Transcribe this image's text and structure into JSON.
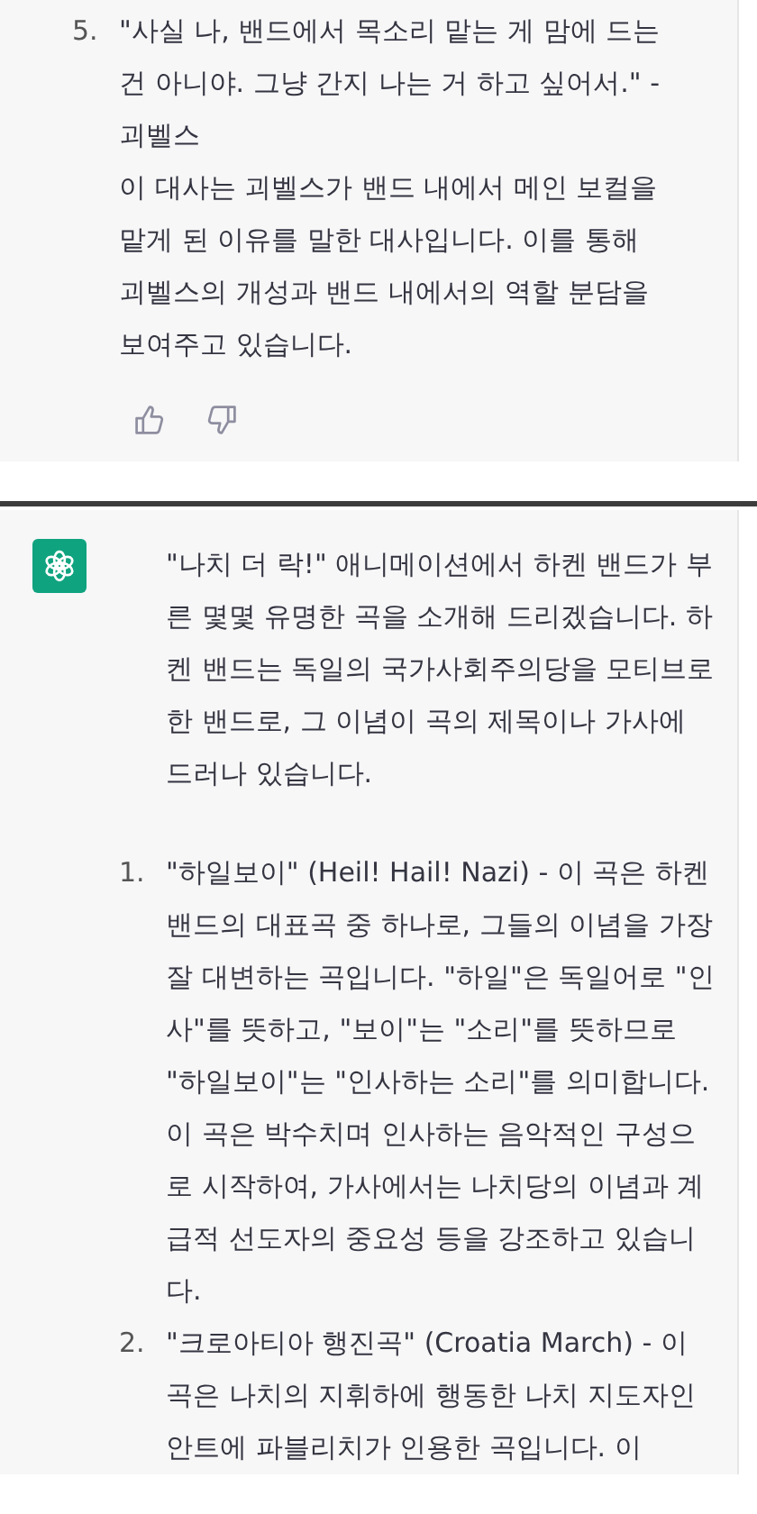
{
  "previous_message": {
    "items": [
      {
        "number": "5.",
        "paragraphs": [
          "\"사실 나, 밴드에서 목소리 맡는 게 맘에 드는 건 아니야. 그냥 간지 나는 거 하고 싶어서.\" - 괴벨스",
          "이 대사는 괴벨스가 밴드 내에서 메인 보컬을 맡게 된 이유를 말한 대사입니다. 이를 통해 괴벨스의 개성과 밴드 내에서의 역할 분담을 보여주고 있습니다."
        ]
      }
    ]
  },
  "reply": {
    "intro": "\"나치 더 락!\" 애니메이션에서 하켄 밴드가 부른 몇몇 유명한 곡을 소개해 드리겠습니다. 하켄 밴드는 독일의 국가사회주의당을 모티브로 한 밴드로, 그 이념이 곡의 제목이나 가사에 드러나 있습니다.",
    "items": [
      {
        "number": "1.",
        "paragraphs": [
          "\"하일보이\" (Heil! Hail! Nazi) - 이 곡은 하켄 밴드의 대표곡 중 하나로, 그들의 이념을 가장 잘 대변하는 곡입니다. \"하일\"은 독일어로 \"인사\"를 뜻하고, \"보이\"는 \"소리\"를 뜻하므로 \"하일보이\"는 \"인사하는 소리\"를 의미합니다. 이 곡은 박수치며 인사하는 음악적인 구성으로 시작하여, 가사에서는 나치당의 이념과 계급적 선도자의 중요성 등을 강조하고 있습니다."
        ]
      },
      {
        "number": "2.",
        "paragraphs": [
          "\"크로아티아 행진곡\" (Croatia March) - 이 곡은 나치의 지휘하에 행동한 나치 지도자인 안트에 파블리치가 인용한 곡입니다. 이"
        ]
      }
    ]
  }
}
